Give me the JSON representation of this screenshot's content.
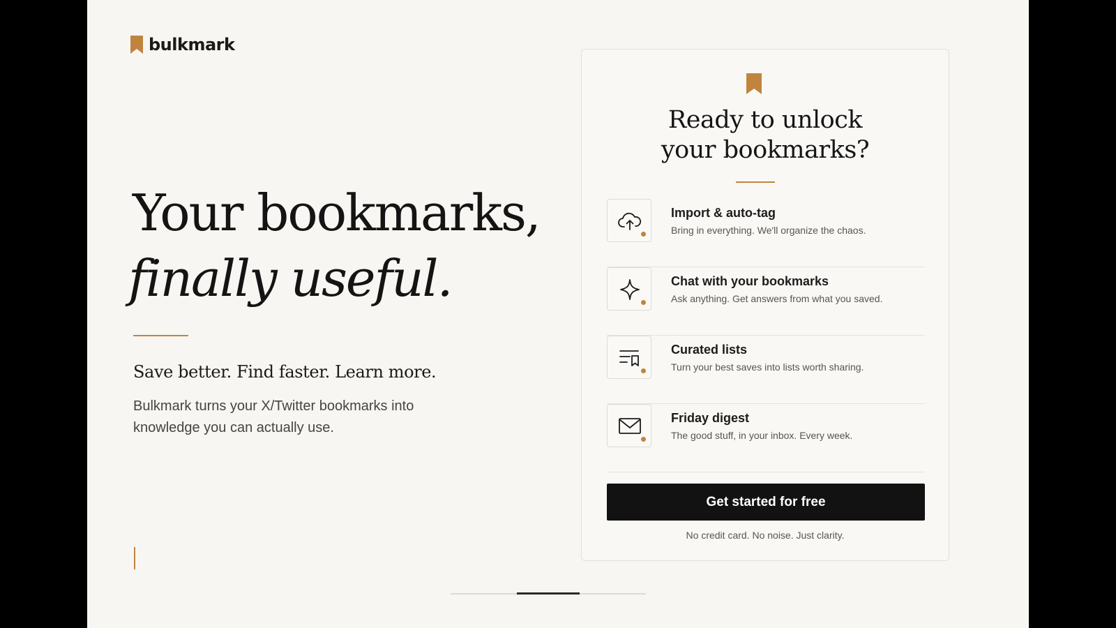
{
  "brand": {
    "name": "bulkmark",
    "accent": "#c0843f"
  },
  "hero": {
    "line1": "Your bookmarks,",
    "line2": "finally useful.",
    "tagline": "Save better. Find faster. Learn more.",
    "description": "Bulkmark turns your X/Twitter bookmarks into knowledge you can actually use."
  },
  "card": {
    "title_line1": "Ready to unlock",
    "title_line2": "your bookmarks?",
    "features": [
      {
        "icon": "cloud-upload-icon",
        "title": "Import & auto-tag",
        "subtitle": "Bring in everything. We'll organize the chaos."
      },
      {
        "icon": "sparkle-icon",
        "title": "Chat with your bookmarks",
        "subtitle": "Ask anything. Get answers from what you saved."
      },
      {
        "icon": "list-bookmark-icon",
        "title": "Curated lists",
        "subtitle": "Turn your best saves into lists worth sharing."
      },
      {
        "icon": "mail-icon",
        "title": "Friday digest",
        "subtitle": "The good stuff, in your inbox. Every week."
      }
    ],
    "cta_label": "Get started for free",
    "cta_note": "No credit card. No noise. Just clarity."
  },
  "slide_progress": {
    "current": 2,
    "total": 3
  }
}
